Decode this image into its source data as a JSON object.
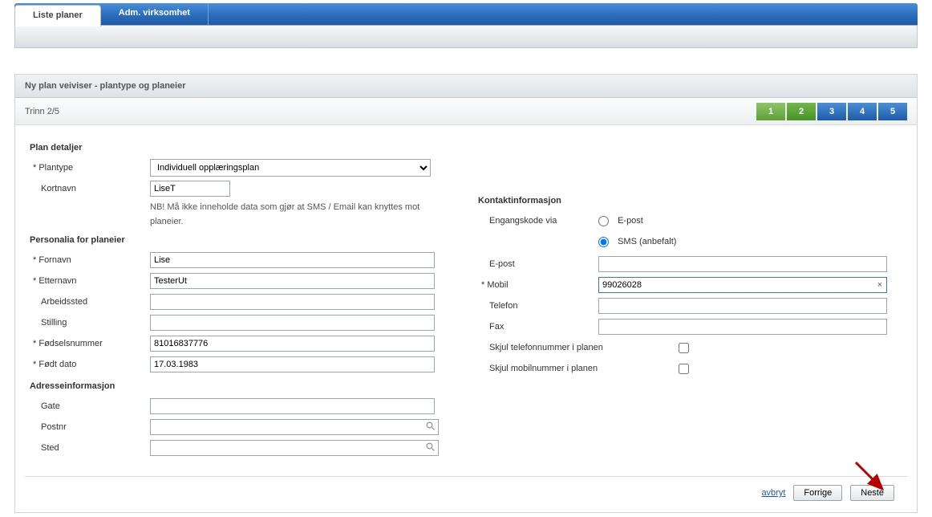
{
  "tabs": {
    "list_plans": "Liste planer",
    "adm_company": "Adm. virksomhet"
  },
  "wizard": {
    "title": "Ny plan veiviser - plantype og planeier",
    "step_text": "Trinn 2/5",
    "steps": [
      "1",
      "2",
      "3",
      "4",
      "5"
    ]
  },
  "sections": {
    "plan_details": "Plan detaljer",
    "personalia": "Personalia for planeier",
    "address": "Adresseinformasjon",
    "contact": "Kontaktinformasjon"
  },
  "labels": {
    "plantype": "Plantype",
    "kortnavn": "Kortnavn",
    "note": "NB! Må ikke inneholde data som gjør at SMS / Email kan knyttes mot planeier.",
    "fornavn": "Fornavn",
    "etternavn": "Etternavn",
    "arbeidssted": "Arbeidssted",
    "stilling": "Stilling",
    "fodselsnummer": "Fødselsnummer",
    "fodt_dato": "Født dato",
    "gate": "Gate",
    "postnr": "Postnr",
    "sted": "Sted",
    "engangskode": "Engangskode via",
    "epost_radio": "E-post",
    "sms_radio": "SMS (anbefalt)",
    "epost": "E-post",
    "mobil": "Mobil",
    "telefon": "Telefon",
    "fax": "Fax",
    "skjul_tlf": "Skjul telefonnummer i planen",
    "skjul_mob": "Skjul mobilnummer i planen"
  },
  "values": {
    "plantype": "Individuell opplæringsplan",
    "kortnavn": "LiseT",
    "fornavn": "Lise",
    "etternavn": "TesterUt",
    "arbeidssted": "",
    "stilling": "",
    "fodselsnummer": "81016837776",
    "fodt_dato": "17.03.1983",
    "gate": "",
    "postnr": "",
    "sted": "",
    "epost": "",
    "mobil": "99026028",
    "telefon": "",
    "fax": ""
  },
  "footer": {
    "cancel": "avbryt",
    "prev": "Forrige",
    "next": "Neste"
  }
}
